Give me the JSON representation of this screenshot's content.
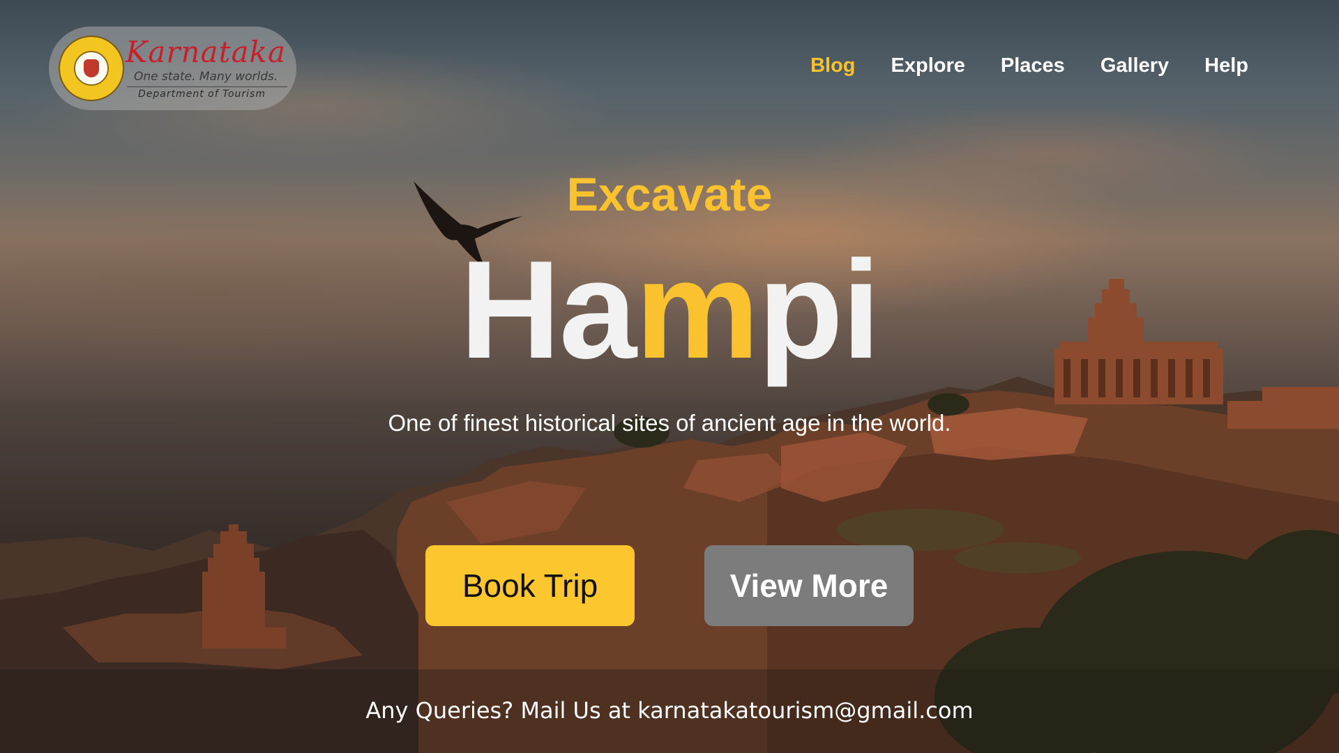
{
  "colors": {
    "accent": "#f9c22e",
    "primary_button": "#fcc62f",
    "secondary_button": "#7c7c7c",
    "logo_red": "#c8202a"
  },
  "logo": {
    "seal_icon": "government-of-karnataka-seal",
    "title": "Karnataka",
    "tagline": "One state. Many worlds.",
    "department": "Department of Tourism"
  },
  "nav": {
    "items": [
      {
        "label": "Blog",
        "active": true
      },
      {
        "label": "Explore",
        "active": false
      },
      {
        "label": "Places",
        "active": false
      },
      {
        "label": "Gallery",
        "active": false
      },
      {
        "label": "Help",
        "active": false
      }
    ]
  },
  "hero": {
    "eyebrow": "Excavate",
    "headline_start": "Ha",
    "headline_accent": "m",
    "headline_end": "pi",
    "subtitle": "One of finest historical sites of ancient age in the world.",
    "background_icon": "hampi-temple-landscape-photo"
  },
  "actions": {
    "book_trip": "Book Trip",
    "view_more": "View More"
  },
  "footer": {
    "contact": "Any Queries? Mail Us at karnatakatourism@gmail.com"
  }
}
